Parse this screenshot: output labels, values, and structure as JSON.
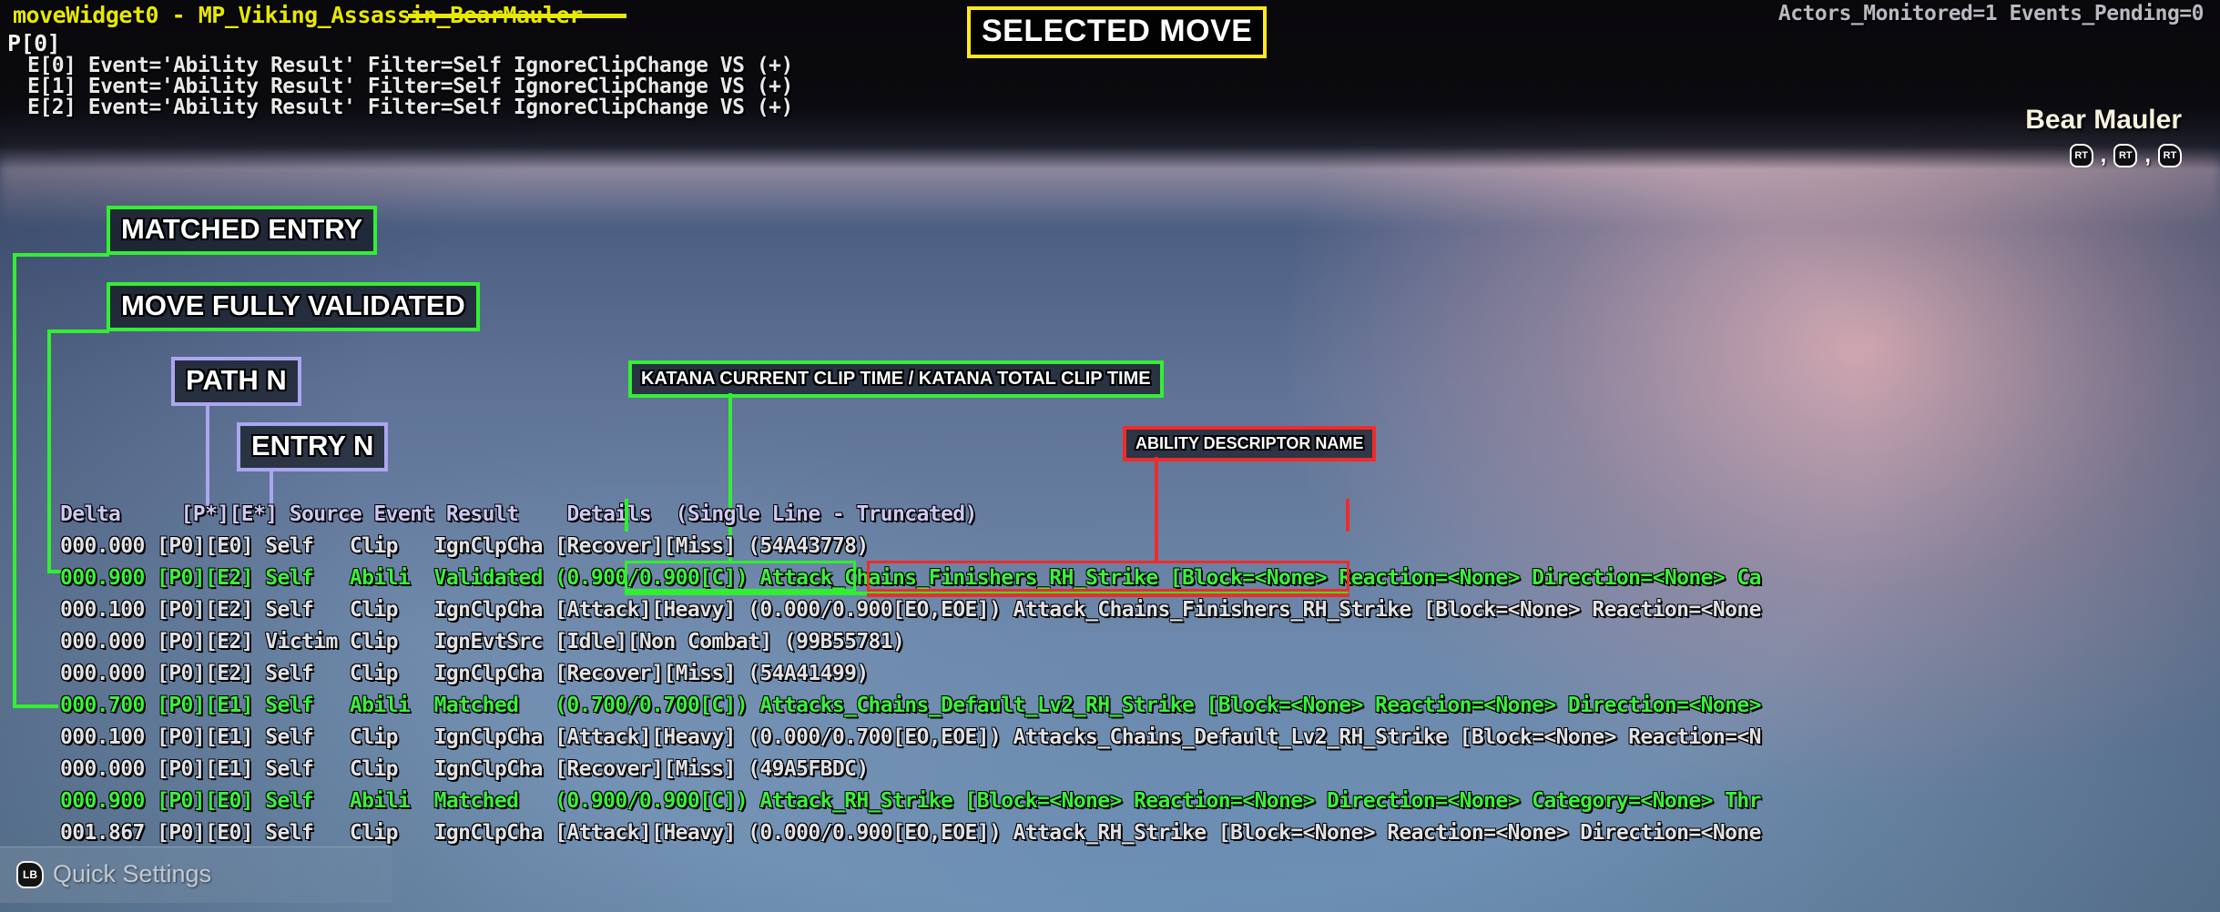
{
  "debug": {
    "title": "moveWidget0 - MP_Viking_Assassin_BearMauler",
    "path_label": "P[0]",
    "events": [
      "E[0] Event='Ability Result' Filter=Self IgnoreClipChange VS (+)",
      "E[1] Event='Ability Result' Filter=Self IgnoreClipChange VS (+)",
      "E[2] Event='Ability Result' Filter=Self IgnoreClipChange VS (+)"
    ],
    "stats": "Actors_Monitored=1 Events_Pending=0"
  },
  "callouts": {
    "selected_move": "SELECTED MOVE",
    "matched_entry": "MATCHED ENTRY",
    "move_validated": "MOVE FULLY VALIDATED",
    "path_n": "PATH  N",
    "entry_n": "ENTRY  N",
    "katana_clip": "KATANA CURRENT CLIP TIME / KATANA TOTAL CLIP TIME",
    "ability_descriptor": "ABILITY DESCRIPTOR NAME"
  },
  "colors": {
    "yellow": "#ffe81f",
    "green": "#33ef33",
    "purple": "#aba6f0",
    "red": "#ef2b2b",
    "title_yellow": "#e8e800"
  },
  "move_hud": {
    "name": "Bear Mauler",
    "inputs": [
      "RT",
      "RT",
      "RT"
    ],
    "separator": ","
  },
  "quick_settings": {
    "button": "LB",
    "label": "Quick Settings"
  },
  "log": {
    "header": "Delta     [P*][E*] Source Event Result    Details  (Single Line - Truncated)",
    "rows": [
      {
        "style": "grey",
        "text": "000.000 [P0][E0] Self   Clip   IgnClpCha [Recover][Miss] (54A43778)"
      },
      {
        "style": "green",
        "text": "000.900 [P0][E2] Self   Abili  Validated (0.900/0.900[C]) Attack_Chains_Finishers_RH_Strike [Block=<None> Reaction=<None> Direction=<None> Ca"
      },
      {
        "style": "grey",
        "text": "000.100 [P0][E2] Self   Clip   IgnClpCha [Attack][Heavy] (0.000/0.900[EO,EOE]) Attack_Chains_Finishers_RH_Strike [Block=<None> Reaction=<None"
      },
      {
        "style": "grey",
        "text": "000.000 [P0][E2] Victim Clip   IgnEvtSrc [Idle][Non Combat] (99B55781)"
      },
      {
        "style": "grey",
        "text": "000.000 [P0][E2] Self   Clip   IgnClpCha [Recover][Miss] (54A41499)"
      },
      {
        "style": "green",
        "text": "000.700 [P0][E1] Self   Abili  Matched   (0.700/0.700[C]) Attacks_Chains_Default_Lv2_RH_Strike [Block=<None> Reaction=<None> Direction=<None>"
      },
      {
        "style": "grey",
        "text": "000.100 [P0][E1] Self   Clip   IgnClpCha [Attack][Heavy] (0.000/0.700[EO,EOE]) Attacks_Chains_Default_Lv2_RH_Strike [Block=<None> Reaction=<N"
      },
      {
        "style": "grey",
        "text": "000.000 [P0][E1] Self   Clip   IgnClpCha [Recover][Miss] (49A5FBDC)"
      },
      {
        "style": "green",
        "text": "000.900 [P0][E0] Self   Abili  Matched   (0.900/0.900[C]) Attack_RH_Strike [Block=<None> Reaction=<None> Direction=<None> Category=<None> Thr"
      },
      {
        "style": "grey",
        "text": "001.867 [P0][E0] Self   Clip   IgnClpCha [Attack][Heavy] (0.000/0.900[EO,EOE]) Attack_RH_Strike [Block=<None> Reaction=<None> Direction=<None"
      }
    ]
  }
}
